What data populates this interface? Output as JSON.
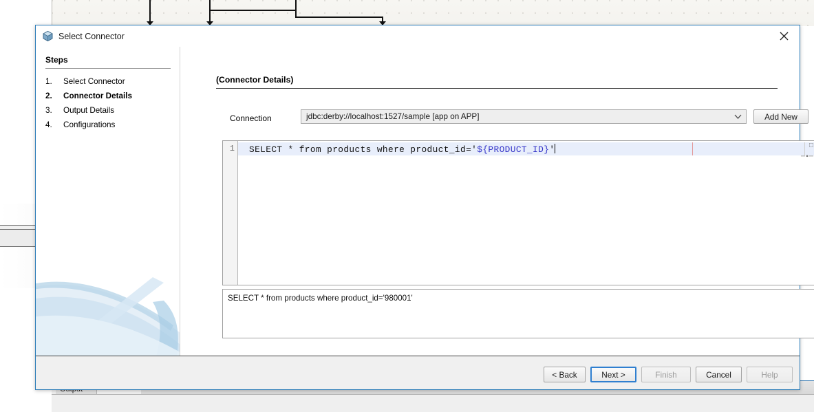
{
  "background": {
    "dock_tab_label": "Output",
    "dock_tab_close_glyph": "×"
  },
  "dialog": {
    "title": "Select Connector",
    "title_icon": "cube-icon",
    "close_icon": "close-icon",
    "steps": {
      "heading": "Steps",
      "items": [
        {
          "num": "1.",
          "label": "Select Connector",
          "active": false
        },
        {
          "num": "2.",
          "label": "Connector Details",
          "active": true
        },
        {
          "num": "3.",
          "label": "Output Details",
          "active": false
        },
        {
          "num": "4.",
          "label": "Configurations",
          "active": false
        }
      ]
    },
    "panel": {
      "heading": "(Connector Details)",
      "connection_label": "Connection",
      "connection_value": "jdbc:derby://localhost:1527/sample [app on APP]",
      "connection_dropdown_icon": "chevron-down-icon",
      "add_new_label": "Add New",
      "editor": {
        "line_number": "1",
        "code_prefix": "SELECT * from products where product_id='",
        "code_variable": "${PRODUCT_ID}",
        "code_suffix": "'",
        "variable_color": "#3434c8",
        "highlight_color": "#e8eefb",
        "annotation_glyph_top": "□",
        "annotation_glyph_bottom": "─▪─"
      },
      "preview_text": "SELECT * from products where product_id='980001'"
    },
    "buttons": {
      "back": {
        "label": "< Back",
        "disabled": false,
        "focused": false
      },
      "next": {
        "label": "Next >",
        "disabled": false,
        "focused": true
      },
      "finish": {
        "label": "Finish",
        "disabled": true,
        "focused": false
      },
      "cancel": {
        "label": "Cancel",
        "disabled": false,
        "focused": false
      },
      "help": {
        "label": "Help",
        "disabled": true,
        "focused": false
      }
    }
  }
}
